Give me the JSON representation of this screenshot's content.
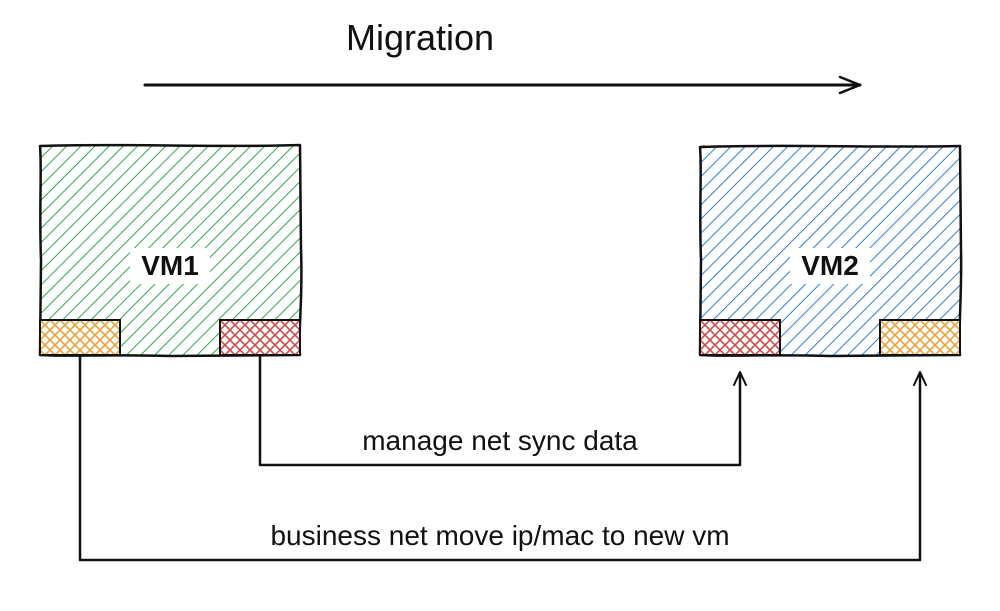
{
  "title": "Migration",
  "vm1": {
    "label": "VM1"
  },
  "vm2": {
    "label": "VM2"
  },
  "connectors": {
    "manage": "manage net sync data",
    "business": "business net move ip/mac to new vm"
  },
  "colors": {
    "stroke": "#111111",
    "vm1_fill": "#2fa84f",
    "vm2_fill": "#2f7fd6",
    "orange": "#e8a43b",
    "red": "#d24a4a"
  }
}
